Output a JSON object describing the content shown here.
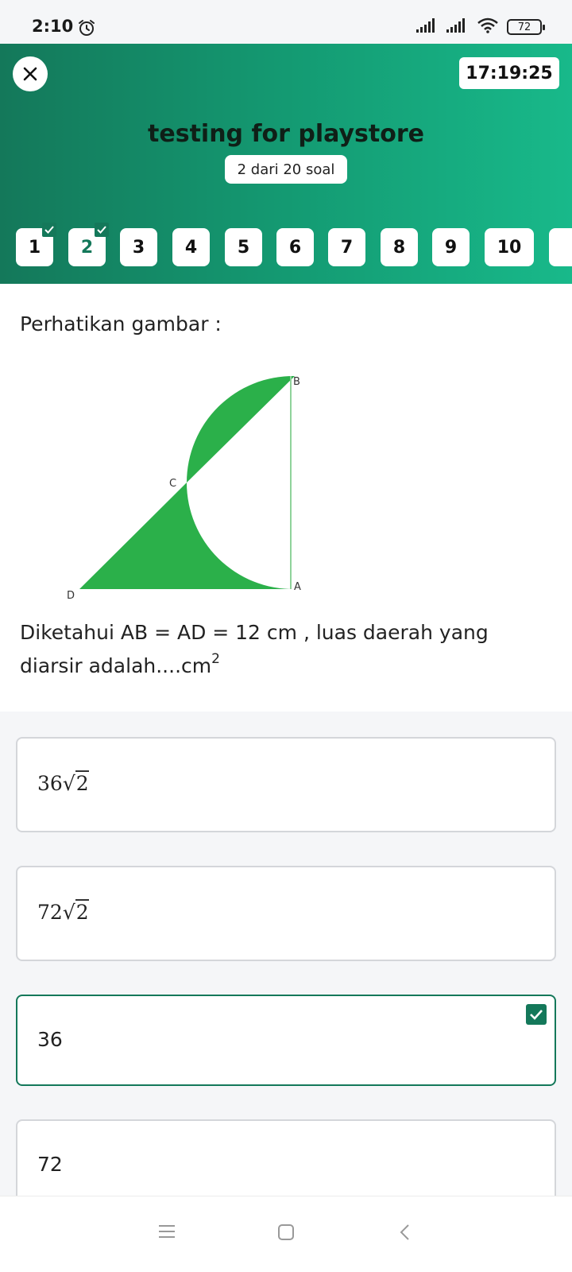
{
  "status": {
    "time": "2:10",
    "battery": "72",
    "icons": [
      "alarm-icon",
      "signal-icon",
      "signal-icon",
      "wifi-icon",
      "battery-icon"
    ]
  },
  "header": {
    "close_icon": "close-icon",
    "timer": "17:19:25",
    "title": "testing for playstore",
    "counter": "2 dari 20 soal"
  },
  "question_nav": [
    {
      "label": "1",
      "answered": true
    },
    {
      "label": "2",
      "answered": true,
      "current": true
    },
    {
      "label": "3"
    },
    {
      "label": "4"
    },
    {
      "label": "5"
    },
    {
      "label": "6"
    },
    {
      "label": "7"
    },
    {
      "label": "8"
    },
    {
      "label": "9"
    },
    {
      "label": "10"
    }
  ],
  "question": {
    "intro": "Perhatikan gambar :",
    "figure_labels": {
      "a": "A",
      "b": "B",
      "c": "C",
      "d": "D"
    },
    "text": "Diketahui AB = AD = 12 cm , luas daerah yang diarsir adalah....cm",
    "text_sup": "2"
  },
  "options": [
    {
      "coef": "36",
      "radicand": "2",
      "selected": false
    },
    {
      "coef": "72",
      "radicand": "2",
      "selected": false
    },
    {
      "text": "36",
      "selected": true
    },
    {
      "text": "72",
      "selected": false
    }
  ],
  "colors": {
    "brand": "#14785a",
    "header_gradient_end": "#18b98a",
    "figure_fill": "#2bb04a"
  },
  "navbar": [
    "menu-icon",
    "home-icon",
    "back-icon"
  ]
}
